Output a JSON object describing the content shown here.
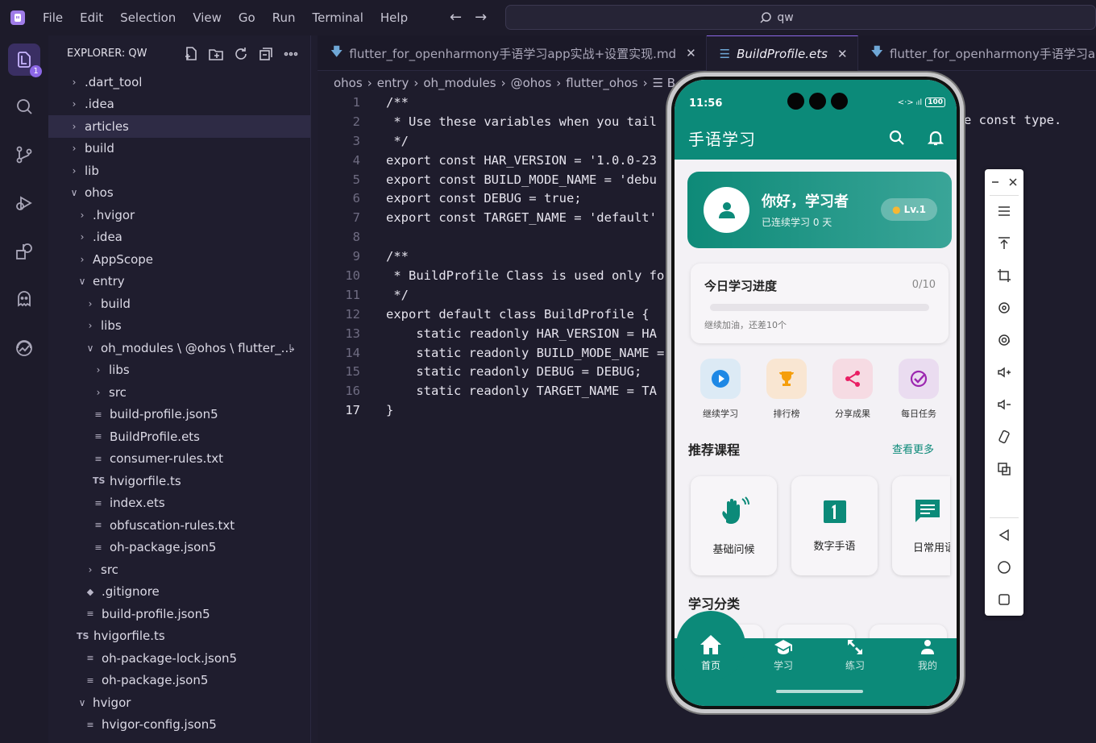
{
  "menu": [
    "File",
    "Edit",
    "Selection",
    "View",
    "Go",
    "Run",
    "Terminal",
    "Help"
  ],
  "command_center": {
    "text": "qw"
  },
  "activity": {
    "explorer_badge": "1"
  },
  "sidebar": {
    "title": "EXPLORER: QW",
    "tree": [
      {
        "label": ".dart_tool",
        "kind": "folder",
        "open": false,
        "depth": 0
      },
      {
        "label": ".idea",
        "kind": "folder",
        "open": false,
        "depth": 0
      },
      {
        "label": "articles",
        "kind": "folder",
        "open": false,
        "depth": 0,
        "selected": true
      },
      {
        "label": "build",
        "kind": "folder",
        "open": false,
        "depth": 0
      },
      {
        "label": "lib",
        "kind": "folder",
        "open": false,
        "depth": 0
      },
      {
        "label": "ohos",
        "kind": "folder",
        "open": true,
        "depth": 0
      },
      {
        "label": ".hvigor",
        "kind": "folder",
        "open": false,
        "depth": 1
      },
      {
        "label": ".idea",
        "kind": "folder",
        "open": false,
        "depth": 1
      },
      {
        "label": "AppScope",
        "kind": "folder",
        "open": false,
        "depth": 1
      },
      {
        "label": "entry",
        "kind": "folder",
        "open": true,
        "depth": 1
      },
      {
        "label": "build",
        "kind": "folder",
        "open": false,
        "depth": 2
      },
      {
        "label": "libs",
        "kind": "folder",
        "open": false,
        "depth": 2
      },
      {
        "label": "oh_modules \\ @ohos \\ flutter_...",
        "kind": "folder",
        "open": true,
        "depth": 2,
        "link": true
      },
      {
        "label": "libs",
        "kind": "folder",
        "open": false,
        "depth": 3
      },
      {
        "label": "src",
        "kind": "folder",
        "open": false,
        "depth": 3
      },
      {
        "label": "build-profile.json5",
        "kind": "file",
        "depth": 3
      },
      {
        "label": "BuildProfile.ets",
        "kind": "file",
        "depth": 3
      },
      {
        "label": "consumer-rules.txt",
        "kind": "file",
        "depth": 3
      },
      {
        "label": "hvigorfile.ts",
        "kind": "ts",
        "depth": 3
      },
      {
        "label": "index.ets",
        "kind": "file",
        "depth": 3
      },
      {
        "label": "obfuscation-rules.txt",
        "kind": "file",
        "depth": 3
      },
      {
        "label": "oh-package.json5",
        "kind": "file",
        "depth": 3
      },
      {
        "label": "src",
        "kind": "folder",
        "open": false,
        "depth": 2
      },
      {
        "label": ".gitignore",
        "kind": "git",
        "depth": 2
      },
      {
        "label": "build-profile.json5",
        "kind": "file",
        "depth": 2
      },
      {
        "label": "hvigorfile.ts",
        "kind": "ts",
        "depth": 1
      },
      {
        "label": "oh-package-lock.json5",
        "kind": "file",
        "depth": 2
      },
      {
        "label": "oh-package.json5",
        "kind": "file",
        "depth": 2
      },
      {
        "label": "hvigor",
        "kind": "folder",
        "open": true,
        "depth": 1
      },
      {
        "label": "hvigor-config.json5",
        "kind": "file",
        "depth": 2
      }
    ]
  },
  "tabs": [
    {
      "label": "flutter_for_openharmony手语学习app实战+设置实现.md",
      "active": false,
      "icon": "🡇"
    },
    {
      "label": "BuildProfile.ets",
      "active": true,
      "icon": "☰"
    },
    {
      "label": "flutter_for_openharmony手语学习app",
      "active": false,
      "icon": "🡇"
    }
  ],
  "breadcrumbs": [
    "ohos",
    "entry",
    "oh_modules",
    "@ohos",
    "flutter_ohos",
    "☰ B"
  ],
  "code": [
    {
      "n": "1",
      "t": "/**"
    },
    {
      "n": "2",
      "t": " * Use these variables when you tail"
    },
    {
      "n": "3",
      "t": " */"
    },
    {
      "n": "4",
      "t": "export const HAR_VERSION = '1.0.0-23"
    },
    {
      "n": "5",
      "t": "export const BUILD_MODE_NAME = 'debu"
    },
    {
      "n": "6",
      "t": "export const DEBUG = true;"
    },
    {
      "n": "7",
      "t": "export const TARGET_NAME = 'default'"
    },
    {
      "n": "8",
      "t": ""
    },
    {
      "n": "9",
      "t": "/**"
    },
    {
      "n": "10",
      "t": " * BuildProfile Class is used only fo"
    },
    {
      "n": "11",
      "t": " */"
    },
    {
      "n": "12",
      "t": "export default class BuildProfile {"
    },
    {
      "n": "13",
      "t": "    static readonly HAR_VERSION = HA"
    },
    {
      "n": "14",
      "t": "    static readonly BUILD_MODE_NAME ="
    },
    {
      "n": "15",
      "t": "    static readonly DEBUG = DEBUG;"
    },
    {
      "n": "16",
      "t": "    static readonly TARGET_NAME = TA"
    },
    {
      "n": "17",
      "t": "}"
    }
  ],
  "code_overflow": "e const type.",
  "phone": {
    "time": "11:56",
    "signal": "<·> ᵢıl",
    "battery": "100",
    "app_title": "手语学习",
    "greeting": "你好，学习者",
    "streak": "已连续学习 0 天",
    "level": "Lv.1",
    "progress": {
      "title": "今日学习进度",
      "count": "0/10",
      "fraction": 0,
      "hint": "继续加油，还差10个"
    },
    "quick": [
      {
        "label": "继续学习",
        "bg": "#dceaf5",
        "color": "#1e88e5",
        "icon": "play-icon"
      },
      {
        "label": "排行榜",
        "bg": "#f9e6d2",
        "color": "#f59e0b",
        "icon": "trophy-icon"
      },
      {
        "label": "分享成果",
        "bg": "#f6dbe3",
        "color": "#e91e63",
        "icon": "share-icon"
      },
      {
        "label": "每日任务",
        "bg": "#eadcf0",
        "color": "#9c27b0",
        "icon": "check-circle-icon"
      }
    ],
    "recommend_title": "推荐课程",
    "see_more": "查看更多",
    "courses": [
      {
        "label": "基础问候",
        "icon": "wave-hand-icon"
      },
      {
        "label": "数字手语",
        "icon": "number-one-icon"
      },
      {
        "label": "日常用语",
        "icon": "chat-icon"
      }
    ],
    "category_title": "学习分类",
    "tabbar": [
      {
        "label": "首页",
        "icon": "home-icon"
      },
      {
        "label": "学习",
        "icon": "school-icon"
      },
      {
        "label": "练习",
        "icon": "expand-icon"
      },
      {
        "label": "我的",
        "icon": "person-icon"
      }
    ]
  }
}
